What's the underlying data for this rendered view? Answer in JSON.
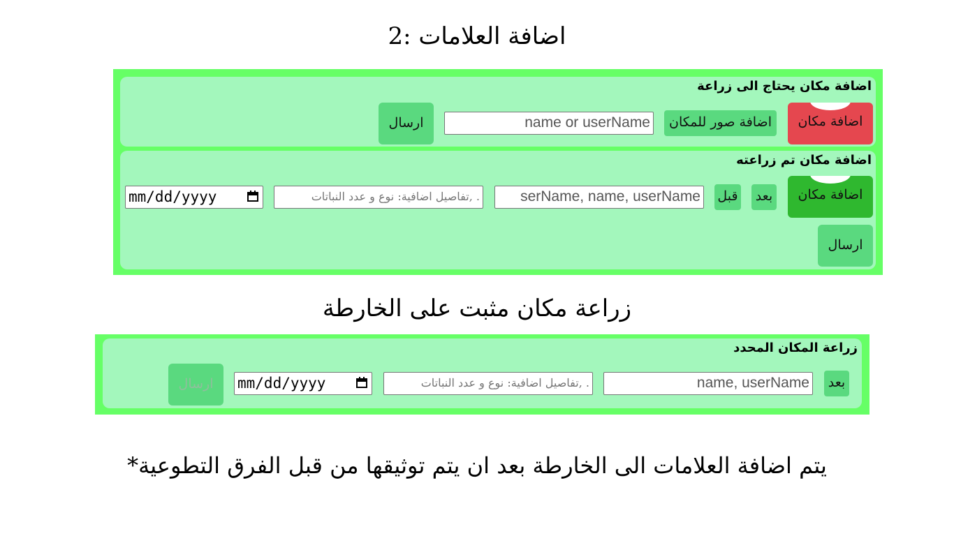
{
  "page": {
    "heading": "اضافة العلامات :2",
    "map_heading": "زراعة مكان مثبت على الخارطة",
    "footnote": "يتم اضافة العلامات الى الخارطة بعد ان يتم توثيقها من قبل الفرق التطوعية*"
  },
  "section_need": {
    "title": "اضافة مكان يحتاج الى زراعة",
    "marker_label": "اضافة مكان",
    "marker_color": "#e5474f",
    "photos_button": "اضافة صور للمكان",
    "name_input_value": "name or userName",
    "send_button": "ارسال"
  },
  "section_planted": {
    "title": "اضافة مكان تم زراعته",
    "marker_label": "اضافة مكان",
    "marker_color": "#2fb82f",
    "after_button": "بعد",
    "before_button": "قبل",
    "names_input_value": "serName, name, userName",
    "details_placeholder": "تفاصيل اضافية: نوع و عدد النباتات, .",
    "date_value": "mm/dd/yyyy",
    "send_button": "ارسال"
  },
  "section_pinned": {
    "title": "زراعة المكان المحدد",
    "after_button": "بعد",
    "names_input_value": "name, userName",
    "details_placeholder": "تفاصيل اضافية: نوع و عدد النباتات, .",
    "date_value": "mm/dd/yyyy",
    "send_button": "ارسال"
  },
  "colors": {
    "frame_green": "#66ff66",
    "card_green": "#a3f7bc",
    "button_green": "#5ad97f"
  },
  "icons": [
    "location-marker-icon",
    "calendar-icon"
  ]
}
